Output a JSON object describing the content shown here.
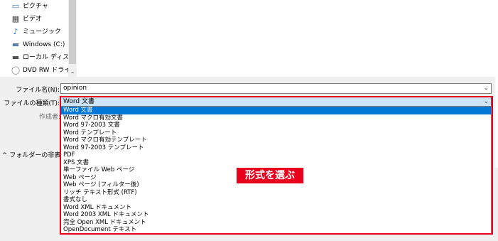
{
  "nav": {
    "items": [
      {
        "label": "ピクチャ",
        "icon": "pictures-icon",
        "glyph": "▭"
      },
      {
        "label": "ビデオ",
        "icon": "video-icon",
        "glyph": "▦"
      },
      {
        "label": "ミュージック",
        "icon": "music-icon",
        "glyph": "♪"
      },
      {
        "label": "Windows (C:)",
        "icon": "drive-icon",
        "glyph": "▬"
      },
      {
        "label": "ローカル ディスク (D",
        "icon": "disk-icon",
        "glyph": "▬"
      },
      {
        "label": "DVD RW ドライブ (",
        "icon": "dvd-icon",
        "glyph": "◯"
      }
    ],
    "scroll_down_glyph": "⌄"
  },
  "form": {
    "filename_label": "ファイル名(N):",
    "filename_value": "opinion",
    "filetype_label": "ファイルの種類(T):",
    "filetype_value": "Word 文書",
    "author_label": "作成者:",
    "dropdown_glyph": "⌄"
  },
  "folders_toggle": "^ フォルダーの非表示",
  "filetype_options": [
    "Word 文書",
    "Word マクロ有効文書",
    "Word 97-2003 文書",
    "Word テンプレート",
    "Word マクロ有効テンプレート",
    "Word 97-2003 テンプレート",
    "PDF",
    "XPS 文書",
    "単一ファイル Web ページ",
    "Web ページ",
    "Web ページ (フィルター後)",
    "リッチ テキスト形式 (RTF)",
    "書式なし",
    "Word XML ドキュメント",
    "Word 2003 XML ドキュメント",
    "完全 Open XML ドキュメント",
    "OpenDocument テキスト"
  ],
  "selected_index": 0,
  "annotation": "形式を選ぶ",
  "colors": {
    "accent": "#0078d7",
    "highlight": "#e8001c"
  }
}
